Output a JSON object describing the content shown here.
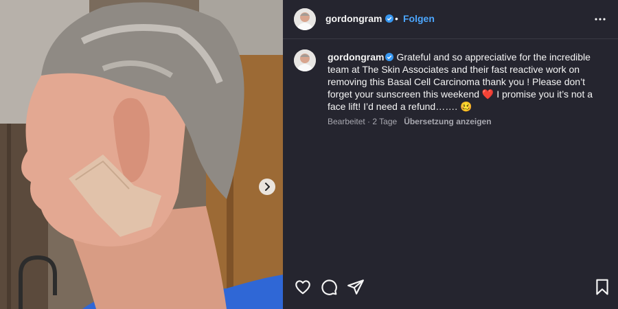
{
  "post": {
    "username": "gordongram",
    "follow_label": "Folgen",
    "separator": "•",
    "caption_user": "gordongram",
    "caption_text": "Grateful and so appreciative for the incredible team at The Skin Associates and their fast reactive work on removing this Basal Cell Carcinoma thank you ! Please don’t forget your sunscreen this weekend ❤️ I promise you it’s not a face lift! I’d need a refund……. 🥴",
    "edited_label": "Bearbeitet · 2 Tage",
    "translate_label": "Übersetzung anzeigen"
  },
  "icons": {
    "verified": "verified-badge-icon",
    "more": "more-options-icon",
    "next": "chevron-right-icon",
    "like": "heart-icon",
    "comment": "comment-icon",
    "share": "paper-plane-icon",
    "save": "bookmark-icon"
  },
  "colors": {
    "background": "#25252f",
    "link": "#4ca7ff",
    "verified": "#3897f0",
    "muted": "#a8a8b0"
  }
}
